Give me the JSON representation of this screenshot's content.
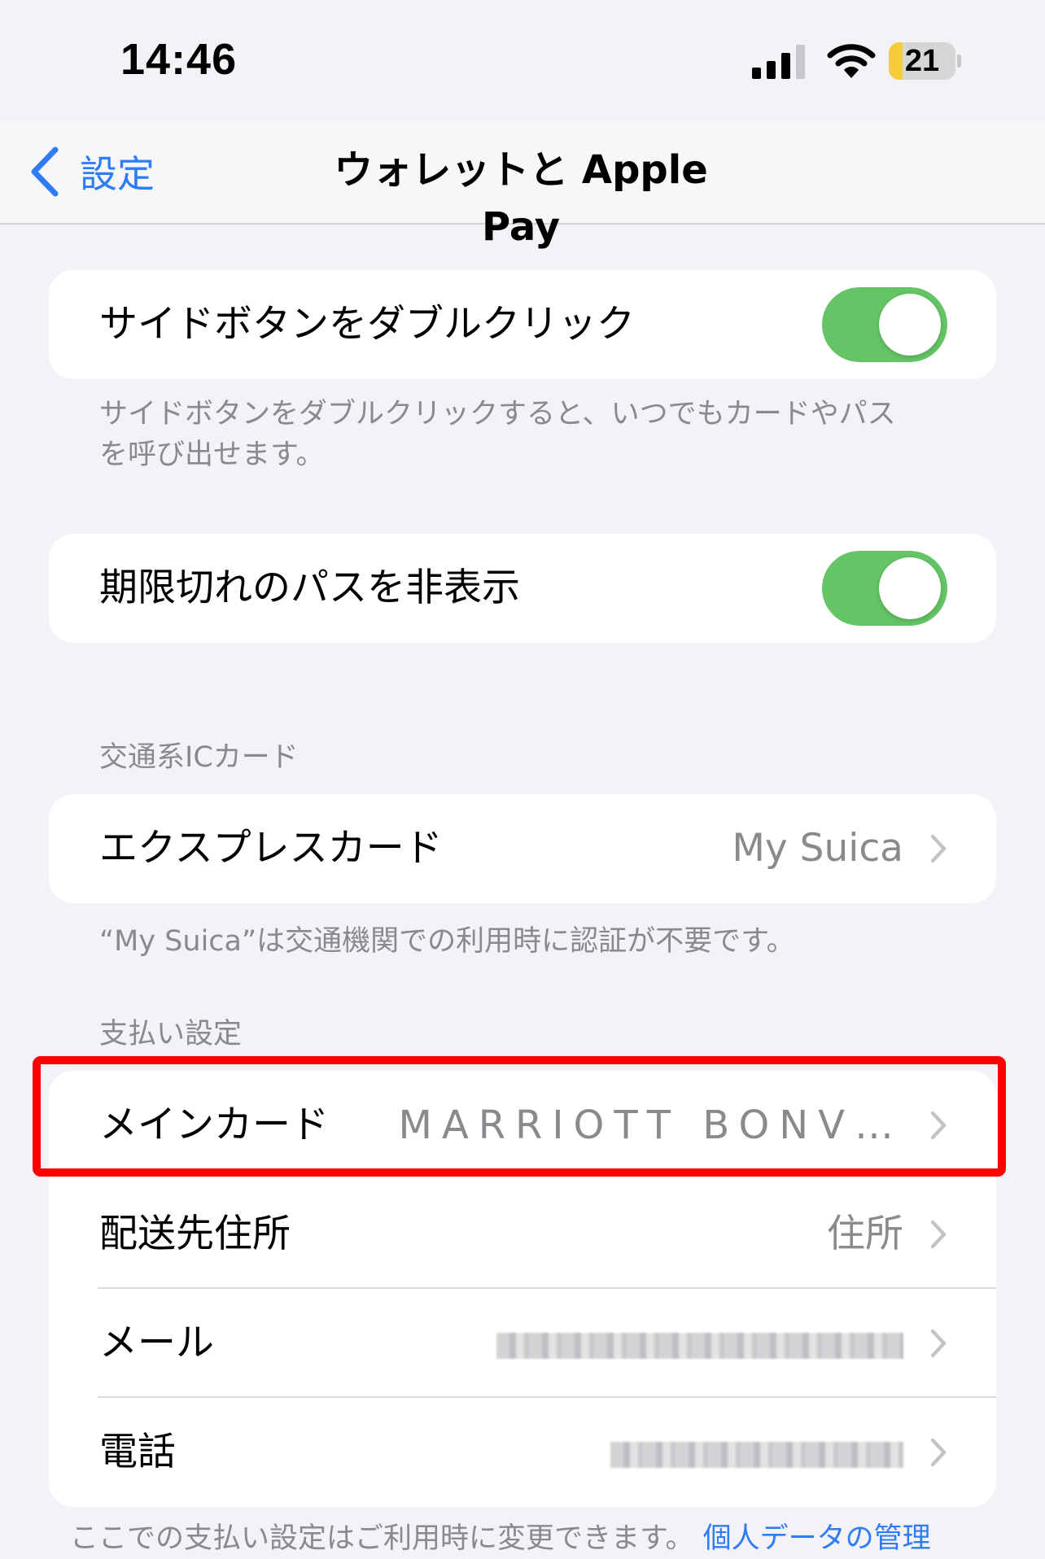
{
  "status_bar": {
    "time": "14:46",
    "battery": "21",
    "battery_level": 0.21
  },
  "nav": {
    "back_label": "設定",
    "title": "ウォレットと Apple Pay"
  },
  "double_click": {
    "label": "サイドボタンをダブルクリック",
    "enabled": true,
    "note_line1": "サイドボタンをダブルクリックすると、いつでもカードやパス",
    "note_line2": "を呼び出せます。"
  },
  "hide_expired": {
    "label": "期限切れのパスを非表示",
    "enabled": true
  },
  "transit": {
    "header": "交通系ICカード",
    "express_label": "エクスプレスカード",
    "express_value": "My Suica",
    "note": "“My Suica”は交通機関での利用時に認証が不要です。"
  },
  "payment": {
    "header": "支払い設定",
    "main_card_label": "メインカード",
    "main_card_value": "MARRIOTT BONV…",
    "shipping_label": "配送先住所",
    "shipping_value": "住所",
    "email_label": "メール",
    "phone_label": "電話"
  },
  "footer": {
    "text": "ここでの支払い設定はご利用時に変更できます。",
    "link": "個人データの管理"
  },
  "colors": {
    "accent": "#2f7cf6",
    "toggle_on": "#65c466",
    "highlight": "#ff0000"
  }
}
